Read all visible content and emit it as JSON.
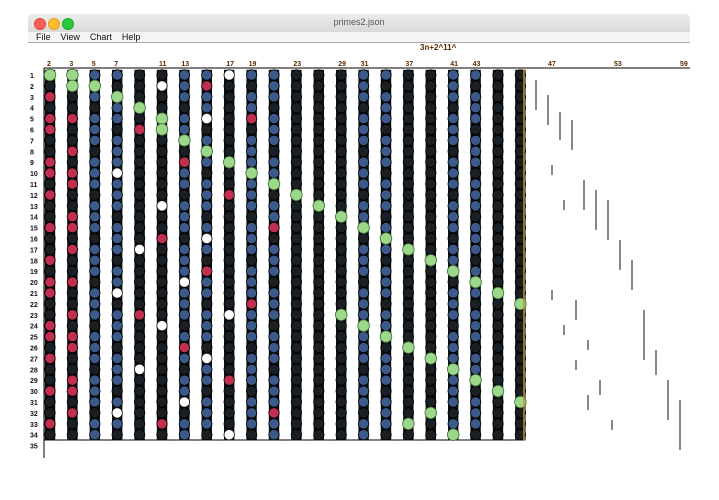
{
  "window": {
    "title": "primes2.json"
  },
  "menu": [
    "File",
    "View",
    "Chart",
    "Help"
  ],
  "chart_data": {
    "type": "scatter",
    "title": "3n+2^11^",
    "top_labels": [
      "2",
      "3",
      "5",
      "7",
      "11",
      "13",
      "17",
      "19",
      "23",
      "29",
      "31",
      "37",
      "41",
      "43",
      "47",
      "53",
      "59"
    ],
    "right_labels": [
      "47",
      "53",
      "59"
    ],
    "row_labels": [
      "1",
      "2",
      "3",
      "4",
      "5",
      "6",
      "7",
      "8",
      "9",
      "10",
      "11",
      "12",
      "13",
      "14",
      "15",
      "16",
      "17",
      "18",
      "19",
      "20",
      "21",
      "22",
      "23",
      "24",
      "25",
      "26",
      "27",
      "28",
      "29",
      "30",
      "31",
      "32",
      "33",
      "34",
      "35"
    ],
    "grid": {
      "columns": 22,
      "rows": 34
    },
    "colors": {
      "dark": "#1a1f24",
      "blue": "#3b5a8a",
      "red": "#c0304e",
      "green": "#9bd88a",
      "hollow": "#ffffff",
      "right_bar": "#1f2a1f"
    }
  }
}
